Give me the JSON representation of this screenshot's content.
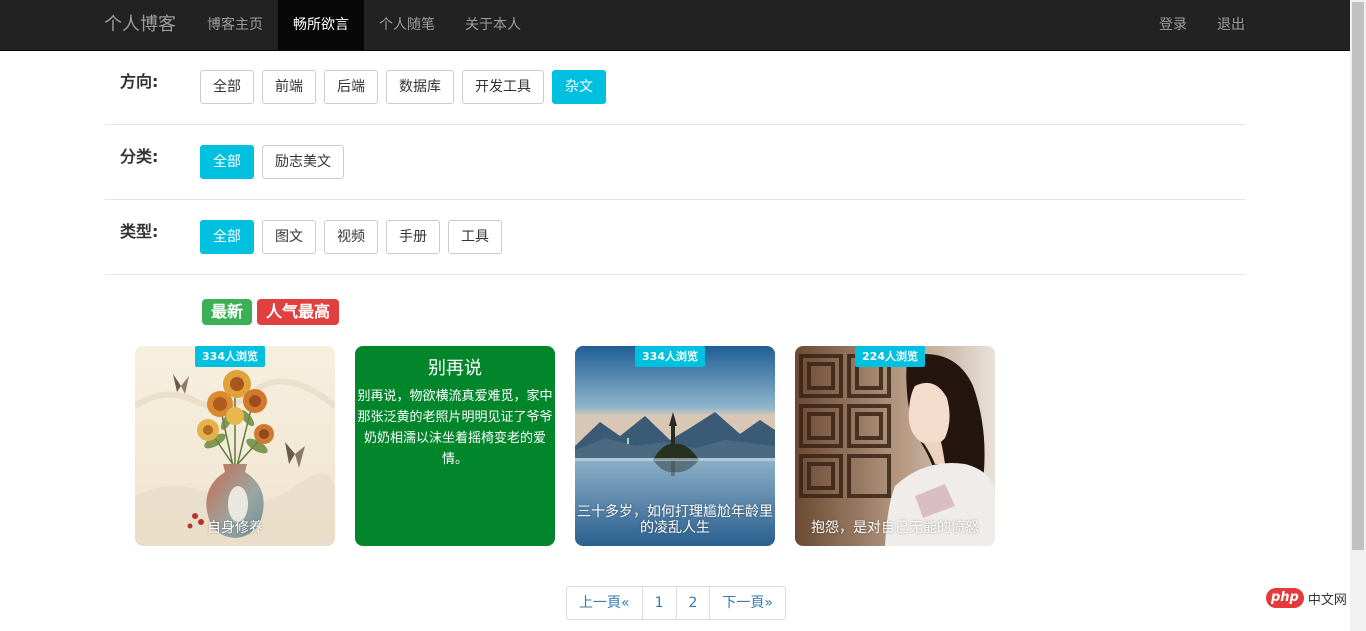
{
  "navbar": {
    "brand": "个人博客",
    "items": [
      {
        "label": "博客主页",
        "active": false
      },
      {
        "label": "畅所欲言",
        "active": true
      },
      {
        "label": "个人随笔",
        "active": false
      },
      {
        "label": "关于本人",
        "active": false
      }
    ],
    "right": {
      "login": "登录",
      "logout": "退出"
    }
  },
  "filters": {
    "direction": {
      "label": "方向:",
      "options": [
        "全部",
        "前端",
        "后端",
        "数据库",
        "开发工具",
        "杂文"
      ],
      "selected": "杂文"
    },
    "category": {
      "label": "分类:",
      "options": [
        "全部",
        "励志美文"
      ],
      "selected": "全部"
    },
    "type": {
      "label": "类型:",
      "options": [
        "全部",
        "图文",
        "视频",
        "手册",
        "工具"
      ],
      "selected": "全部"
    }
  },
  "sort": {
    "newest": "最新",
    "popular": "人气最高"
  },
  "cards": [
    {
      "views": "334人浏览",
      "caption": "自身修养",
      "image": "flower-vase-painting"
    },
    {
      "title": "别再说",
      "body": "别再说，物欲横流真爱难觅，家中那张泛黄的老照片明明见证了爷爷奶奶相濡以沫坐着摇椅变老的爱情。"
    },
    {
      "views": "334人浏览",
      "caption": "三十多岁，如何打理尴尬年龄里的凌乱人生",
      "image": "lake-island-landscape"
    },
    {
      "views": "224人浏览",
      "caption": "抱怨，是对自己无能的愤怒",
      "image": "girl-by-window"
    }
  ],
  "pagination": {
    "prev": "上一頁«",
    "pages": [
      "1",
      "2"
    ],
    "next": "下一頁»"
  },
  "watermark": {
    "logo": "php",
    "text": "中文网"
  },
  "colors": {
    "accent": "#00c0e0",
    "navbar": "#222222",
    "card_green": "#02862c",
    "badge_green": "#3cb054",
    "badge_red": "#e0403f"
  }
}
